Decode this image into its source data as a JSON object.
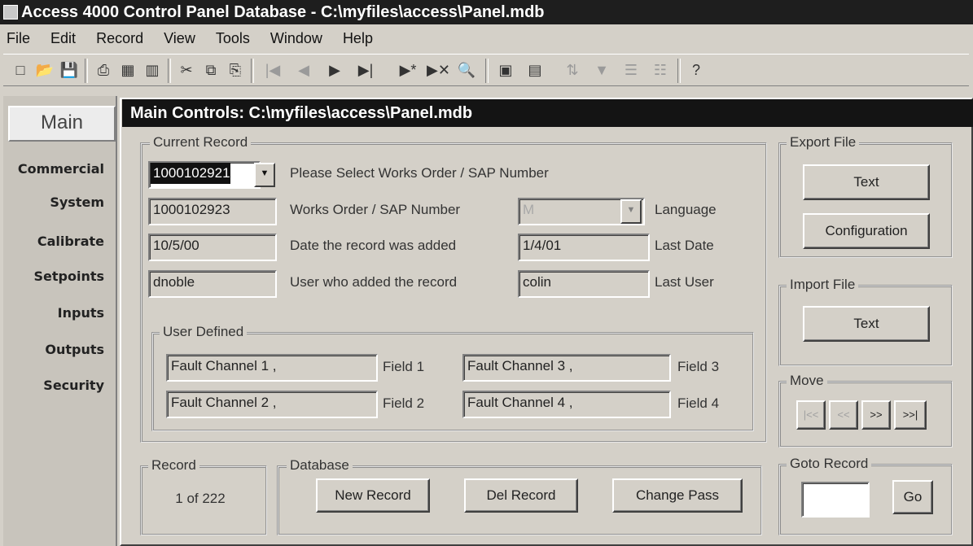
{
  "app": {
    "title": "Access 4000 Control Panel Database - C:\\myfiles\\access\\Panel.mdb"
  },
  "menu": [
    "File",
    "Edit",
    "Record",
    "View",
    "Tools",
    "Window",
    "Help"
  ],
  "toolbar": {
    "icons": [
      "new-file-icon",
      "open-icon",
      "save-icon",
      "print-icon",
      "print-preview-icon",
      "clipboard-icon",
      "cut-icon",
      "copy-icon",
      "paste-icon",
      "first-record-icon",
      "previous-record-icon",
      "next-record-icon",
      "last-record-icon",
      "new-record-icon",
      "delete-record-icon",
      "find-icon",
      "database-icon",
      "form-icon",
      "sort-icon",
      "filter-icon",
      "apply-filter-icon",
      "remove-filter-icon",
      "help-icon"
    ]
  },
  "nav": {
    "main": "Main",
    "items": [
      "Commercial",
      "System",
      "Calibrate",
      "Setpoints",
      "Inputs",
      "Outputs",
      "Security"
    ]
  },
  "form": {
    "title": "Main Controls: C:\\myfiles\\access\\Panel.mdb",
    "current_record": {
      "group_label": "Current Record",
      "combo_value": "1000102921",
      "select_label": "Please Select Works Order / SAP Number",
      "works_order_value": "1000102923",
      "works_order_label": "Works Order / SAP Number",
      "language_value": "M",
      "language_label": "Language",
      "date_added_value": "10/5/00",
      "date_added_label": "Date the record was added",
      "last_date_value": "1/4/01",
      "last_date_label": "Last Date",
      "user_added_value": "dnoble",
      "user_added_label": "User who added the record",
      "last_user_value": "colin",
      "last_user_label": "Last User"
    },
    "user_defined": {
      "group_label": "User Defined",
      "field1_value": "Fault Channel 1 ,",
      "field1_label": "Field 1",
      "field2_value": "Fault Channel 2 ,",
      "field2_label": "Field 2",
      "field3_value": "Fault Channel 3 ,",
      "field3_label": "Field 3",
      "field4_value": "Fault Channel 4 ,",
      "field4_label": "Field 4"
    },
    "record": {
      "group_label": "Record",
      "counter": "1 of 222"
    },
    "database": {
      "group_label": "Database",
      "new_record": "New Record",
      "del_record": "Del Record",
      "change_pass": "Change Pass"
    },
    "export_file": {
      "group_label": "Export File",
      "text_button": "Text",
      "configuration_button": "Configuration"
    },
    "import_file": {
      "group_label": "Import File",
      "text_button": "Text"
    },
    "move": {
      "group_label": "Move",
      "first": "|<<",
      "prev": "<<",
      "next": ">>",
      "last": ">>|"
    },
    "goto": {
      "group_label": "Goto Record",
      "go_button": "Go"
    }
  },
  "colors": {
    "window_bg": "#d4d0c8",
    "title_bar": "#1e1e1e"
  }
}
